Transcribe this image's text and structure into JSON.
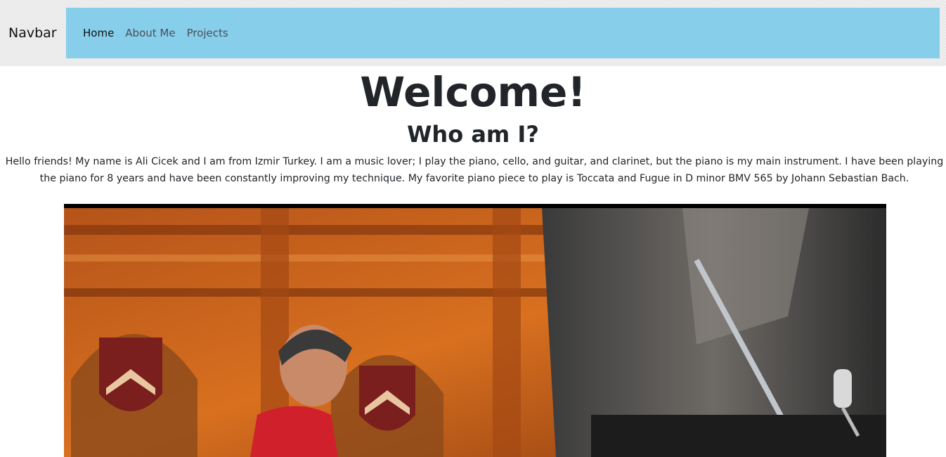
{
  "navbar": {
    "brand": "Navbar",
    "links": [
      {
        "label": "Home",
        "active": true
      },
      {
        "label": "About Me",
        "active": false
      },
      {
        "label": "Projects",
        "active": false
      }
    ],
    "background_color": "#87ceeb"
  },
  "main": {
    "heading": "Welcome!",
    "subheading": "Who am I?",
    "bio": "Hello friends! My name is Ali Cicek and I am from Izmir Turkey. I am a music lover; I play the piano, cello, and guitar, and clarinet, but the piano is my main instrument. I have been playing the piano for 8 years and have been constantly improving my technique. My favorite piano piece to play is Toccata and Fugue in D minor BMV 565 by Johann Sebastian Bach."
  },
  "photo": {
    "subject": "boy-playing-grand-piano-in-wood-paneled-hall"
  }
}
